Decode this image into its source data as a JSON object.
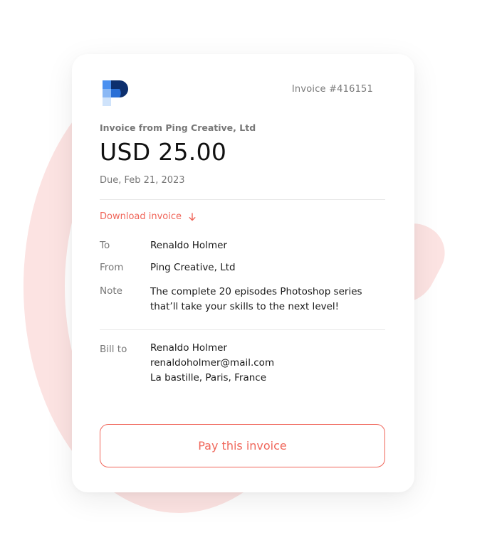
{
  "colors": {
    "accent": "#f0665a",
    "background_shape": "#fce3e2",
    "logo_dark": "#0d2f6e",
    "logo_blue": "#4a90f0",
    "logo_light": "#cfe3fb"
  },
  "header": {
    "logo_icon": "ping-creative-logo",
    "invoice_number": "Invoice #416151"
  },
  "summary": {
    "from_line": "Invoice from Ping Creative, Ltd",
    "amount": "USD 25.00",
    "due": "Due, Feb 21, 2023"
  },
  "download": {
    "label": "Download invoice",
    "icon": "arrow-down-icon"
  },
  "details": {
    "to": {
      "label": "To",
      "value": "Renaldo Holmer"
    },
    "from": {
      "label": "From",
      "value": "Ping Creative, Ltd"
    },
    "note": {
      "label": "Note",
      "line1": "The complete 20 episodes Photoshop series",
      "line2": "that’ll take your skills to the next level!"
    }
  },
  "bill_to": {
    "label": "Bill to",
    "name": "Renaldo Holmer",
    "email": "renaldoholmer@mail.com",
    "address": "La bastille, Paris, France"
  },
  "action": {
    "pay_label": "Pay this invoice"
  }
}
